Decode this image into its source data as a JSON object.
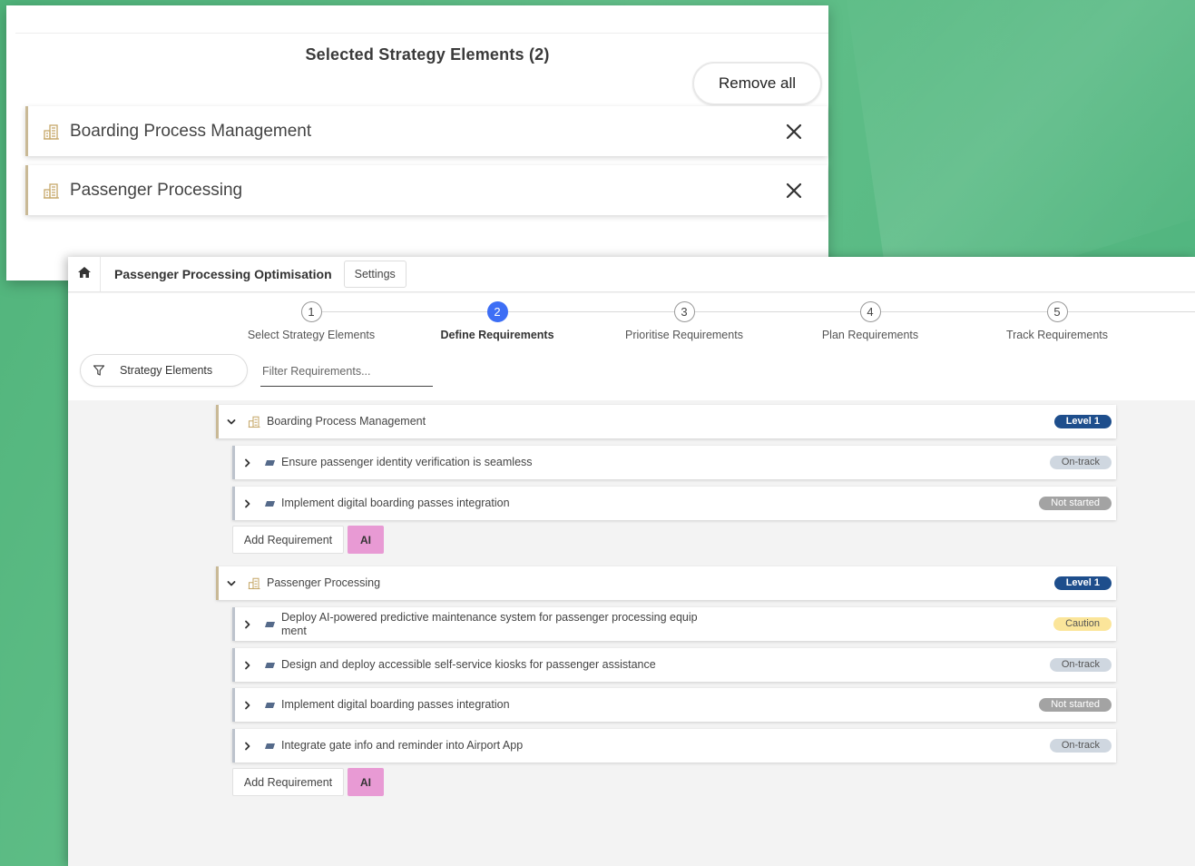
{
  "selection_panel": {
    "title": "Selected Strategy Elements (2)",
    "remove_all_label": "Remove all",
    "items": [
      {
        "label": "Boarding Process Management",
        "icon": "building-icon",
        "close_icon": "close-icon"
      },
      {
        "label": "Passenger Processing",
        "icon": "building-icon",
        "close_icon": "close-icon"
      }
    ]
  },
  "header": {
    "home_icon": "home-icon",
    "title": "Passenger Processing Optimisation",
    "settings_label": "Settings"
  },
  "stepper": {
    "active_step": 2,
    "steps": [
      {
        "number": "1",
        "label": "Select Strategy Elements"
      },
      {
        "number": "2",
        "label": "Define Requirements"
      },
      {
        "number": "3",
        "label": "Prioritise Requirements"
      },
      {
        "number": "4",
        "label": "Plan Requirements"
      },
      {
        "number": "5",
        "label": "Track Requirements"
      }
    ]
  },
  "filters": {
    "strategy_label": "Strategy Elements",
    "filter_icon": "filter-icon",
    "search_placeholder": "Filter Requirements..."
  },
  "groups": [
    {
      "name": "Boarding Process Management",
      "level": "Level 1",
      "requirements": [
        {
          "text": "Ensure passenger identity verification is seamless",
          "status": "On-track"
        },
        {
          "text": "Implement digital boarding passes integration",
          "status": "Not started"
        }
      ],
      "add_label": "Add Requirement",
      "ai_label": "AI"
    },
    {
      "name": "Passenger Processing",
      "level": "Level 1",
      "requirements": [
        {
          "text": "Deploy AI-powered predictive maintenance system for passenger processing equip ment",
          "status": "Caution"
        },
        {
          "text": "Design and deploy accessible self-service kiosks for passenger assistance",
          "status": "On-track"
        },
        {
          "text": "Implement digital boarding passes integration",
          "status": "Not started"
        },
        {
          "text": "Integrate gate info and reminder into Airport App",
          "status": "On-track"
        }
      ],
      "add_label": "Add Requirement",
      "ai_label": "AI"
    }
  ],
  "colors": {
    "background": "#57b983",
    "element_accent": "#c9b996",
    "active_step": "#3d6ef5",
    "level_badge": "#1e4e8c",
    "ontrack_badge": "#cfd7e0",
    "notstarted_badge": "#a3a3a3",
    "caution_badge": "#fbe59a",
    "ai_button": "#e89ad4"
  }
}
